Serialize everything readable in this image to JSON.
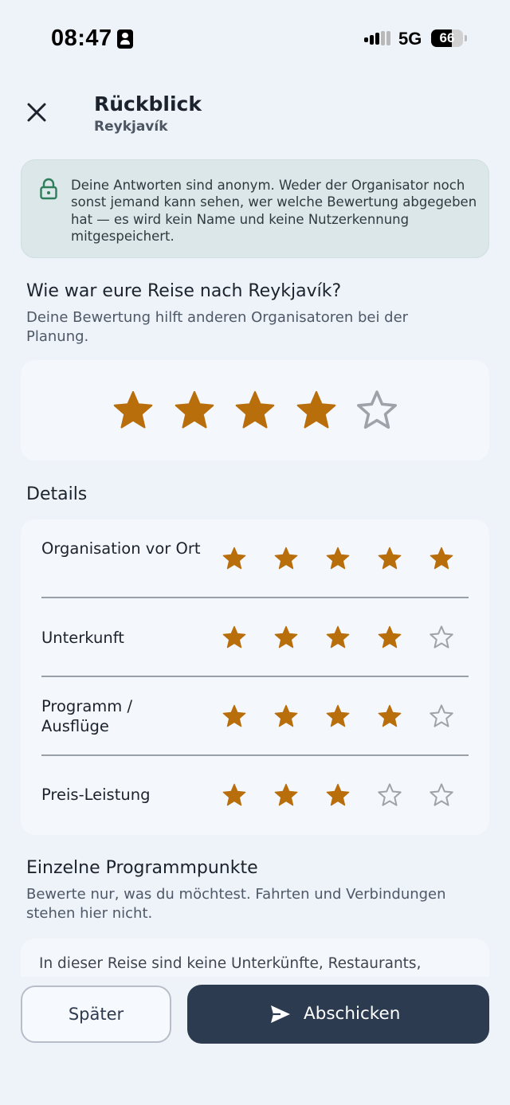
{
  "status_bar": {
    "time": "08:47",
    "network": "5G",
    "battery": "66",
    "battery_level": 0.66
  },
  "header": {
    "title": "Rückblick",
    "subtitle": "Reykjavík",
    "close_icon": "close-icon"
  },
  "notice": {
    "icon": "lock-icon",
    "text": "Deine Antworten sind anonym. Weder der Organisator noch sonst jemand kann sehen, wer welche Bewertung abgegeben hat — es wird kein Name und keine Nutzerkennung mitgespeichert."
  },
  "overall": {
    "title": "Wie war eure Reise nach Reykjavík?",
    "description": "Deine Bewertung hilft anderen Organisatoren bei der Planung.",
    "rating": 4,
    "max": 5
  },
  "details": {
    "title": "Details",
    "rows": [
      {
        "label": "Organisation vor Ort",
        "rating": 5
      },
      {
        "label": "Unterkunft",
        "rating": 4
      },
      {
        "label": "Programm / Ausflüge",
        "rating": 4
      },
      {
        "label": "Preis-Leistung",
        "rating": 3
      }
    ]
  },
  "program": {
    "title": "Einzelne Programmpunkte",
    "description": "Bewerte nur, was du möchtest. Fahrten und Verbindungen stehen hier nicht.",
    "empty_text": "In dieser Reise sind keine Unterkünfte, Restaurants,"
  },
  "actions": {
    "later_label": "Später",
    "send_label": "Abschicken",
    "send_icon": "send-icon"
  },
  "colors": {
    "star_filled": "#b96e0c",
    "star_empty": "#9ea3aa",
    "accent_dark": "#2d3b50",
    "notice_bg": "#dbe7e8",
    "lock_green": "#2e7d5b"
  }
}
